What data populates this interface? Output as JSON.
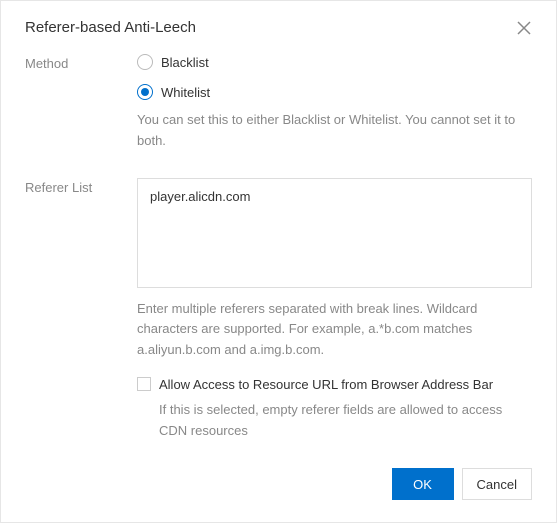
{
  "title": "Referer-based Anti-Leech",
  "method": {
    "label": "Method",
    "options": [
      {
        "label": "Blacklist",
        "checked": false
      },
      {
        "label": "Whitelist",
        "checked": true
      }
    ],
    "help": "You can set this to either Blacklist or Whitelist. You cannot set it to both."
  },
  "refererList": {
    "label": "Referer List",
    "value": "player.alicdn.com",
    "help": "Enter multiple referers separated with break lines. Wildcard characters are supported. For example, a.*b.com matches a.aliyun.b.com and a.img.b.com."
  },
  "allowAccess": {
    "label": "Allow Access to Resource URL from Browser Address Bar",
    "checked": false,
    "help": "If this is selected, empty referer fields are allowed to access CDN resources"
  },
  "footer": {
    "ok": "OK",
    "cancel": "Cancel"
  }
}
